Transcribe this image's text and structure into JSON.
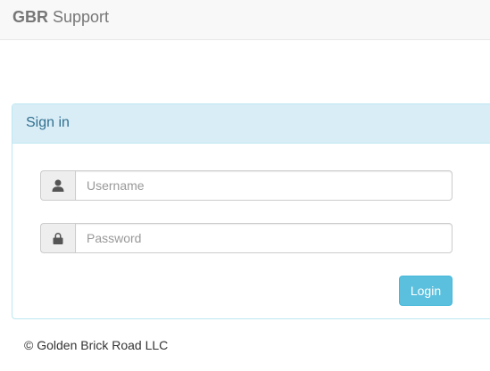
{
  "navbar": {
    "brand_bold": "GBR",
    "brand_rest": " Support"
  },
  "panel": {
    "title": "Sign in"
  },
  "form": {
    "username_placeholder": "Username",
    "username_icon": "user-icon",
    "password_placeholder": "Password",
    "password_icon": "lock-icon",
    "login_label": "Login"
  },
  "footer": {
    "copyright": "© Golden Brick Road LLC"
  },
  "colors": {
    "panel_border": "#bce8f1",
    "panel_heading_bg": "#d9edf7",
    "panel_title": "#31708f",
    "button_bg": "#5bc0de"
  }
}
